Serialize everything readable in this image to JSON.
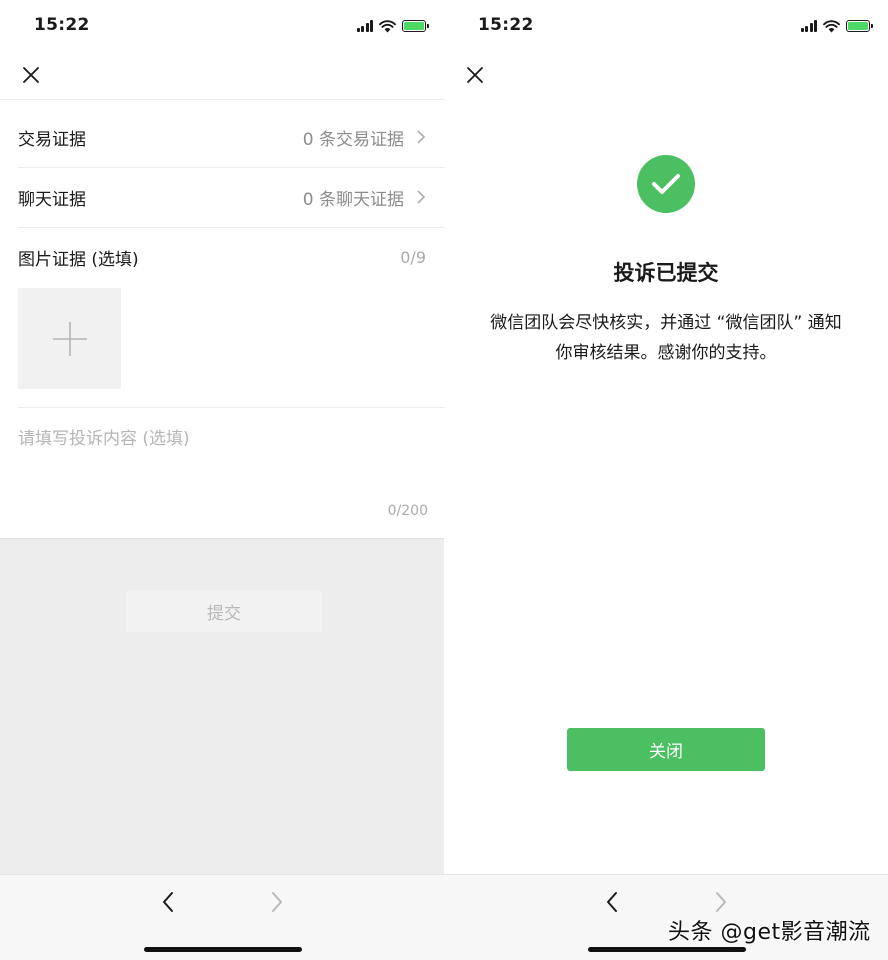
{
  "status_bar": {
    "time": "15:22"
  },
  "complaint_form": {
    "rows": [
      {
        "label": "交易证据",
        "value": "0 条交易证据"
      },
      {
        "label": "聊天证据",
        "value": "0 条聊天证据"
      }
    ],
    "image_evidence": {
      "label": "图片证据 (选填)",
      "count": "0/9"
    },
    "content": {
      "placeholder": "请填写投诉内容 (选填)",
      "value": "",
      "counter": "0/200"
    },
    "submit_label": "提交"
  },
  "success_screen": {
    "title": "投诉已提交",
    "message": "微信团队会尽快核实，并通过 “微信团队” 通知你审核结果。感谢你的支持。",
    "close_label": "关闭"
  },
  "watermark": "头条 @get影音潮流",
  "colors": {
    "accent_green": "#4bbf62",
    "battery_green": "#4cd964",
    "disabled_text": "#b8b8b8",
    "secondary_text": "#8c8c8c"
  },
  "icons": [
    "close-icon",
    "chevron-right-icon",
    "plus-icon",
    "check-icon",
    "back-arrow-icon",
    "forward-arrow-icon",
    "signal-icon",
    "wifi-icon",
    "battery-icon"
  ]
}
